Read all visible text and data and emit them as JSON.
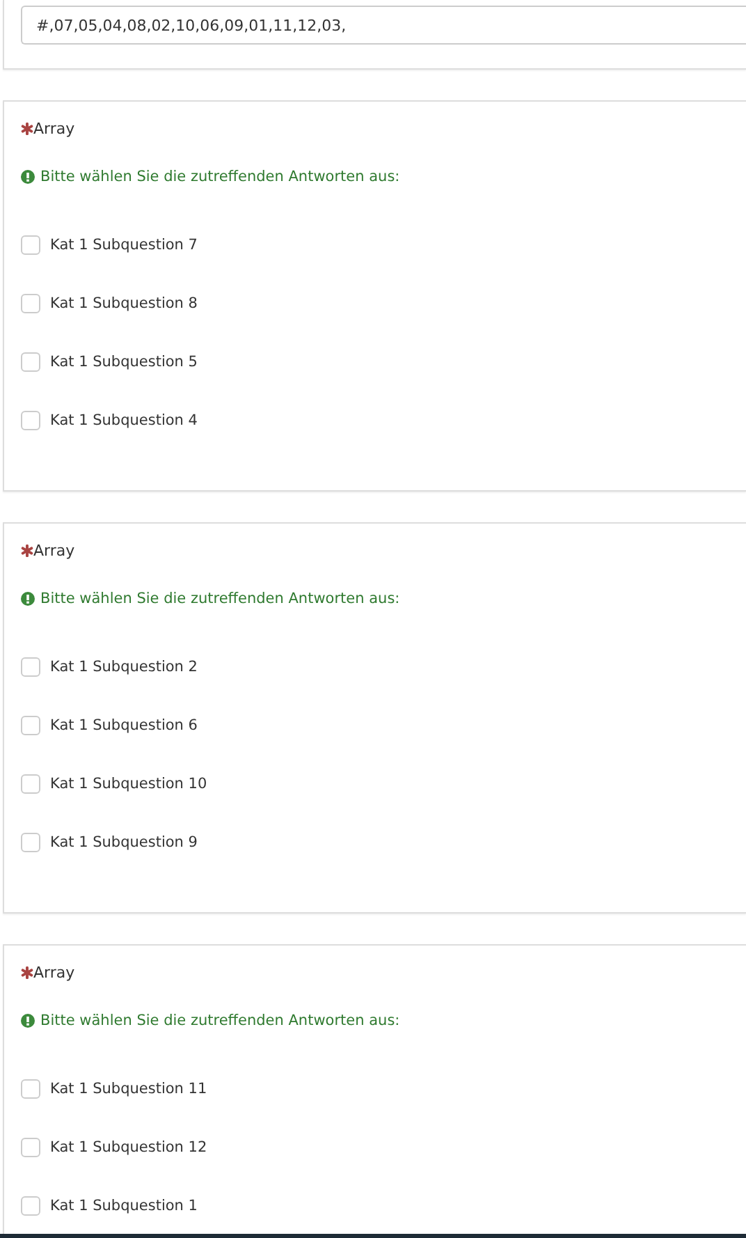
{
  "answer_field": {
    "value": "#,07,05,04,08,02,10,06,09,01,11,12,03,"
  },
  "questions": [
    {
      "title": "Array",
      "required": true,
      "hint": "Bitte wählen Sie die zutreffenden Antworten aus:",
      "options": [
        {
          "label": "Kat 1 Subquestion 7",
          "checked": false
        },
        {
          "label": "Kat 1 Subquestion 8",
          "checked": false
        },
        {
          "label": "Kat 1 Subquestion 5",
          "checked": false
        },
        {
          "label": "Kat 1 Subquestion 4",
          "checked": false
        }
      ]
    },
    {
      "title": "Array",
      "required": true,
      "hint": "Bitte wählen Sie die zutreffenden Antworten aus:",
      "options": [
        {
          "label": "Kat 1 Subquestion 2",
          "checked": false
        },
        {
          "label": "Kat 1 Subquestion 6",
          "checked": false
        },
        {
          "label": "Kat 1 Subquestion 10",
          "checked": false
        },
        {
          "label": "Kat 1 Subquestion 9",
          "checked": false
        }
      ]
    },
    {
      "title": "Array",
      "required": true,
      "hint": "Bitte wählen Sie die zutreffenden Antworten aus:",
      "options": [
        {
          "label": "Kat 1 Subquestion 11",
          "checked": false
        },
        {
          "label": "Kat 1 Subquestion 12",
          "checked": false
        },
        {
          "label": "Kat 1 Subquestion 1",
          "checked": false
        }
      ]
    }
  ]
}
